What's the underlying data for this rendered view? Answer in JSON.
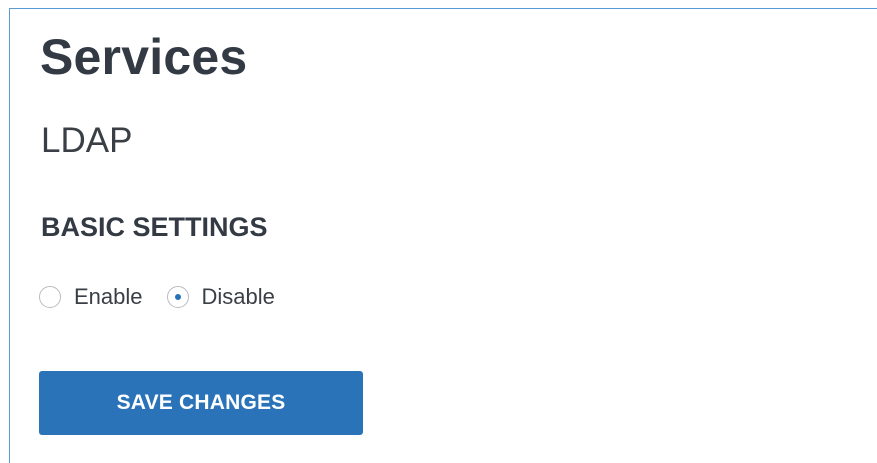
{
  "page": {
    "title": "Services",
    "subtitle": "LDAP"
  },
  "basic_settings": {
    "heading": "BASIC SETTINGS",
    "options": [
      {
        "label": "Enable",
        "checked": false
      },
      {
        "label": "Disable",
        "checked": true
      }
    ]
  },
  "actions": {
    "save_label": "SAVE CHANGES"
  },
  "colors": {
    "accent": "#2a73b8",
    "frame_border": "#5b9bd5",
    "text": "#333a44"
  },
  "icons": {
    "radio_unchecked": "radio-unchecked-icon",
    "radio_checked": "radio-checked-icon"
  }
}
